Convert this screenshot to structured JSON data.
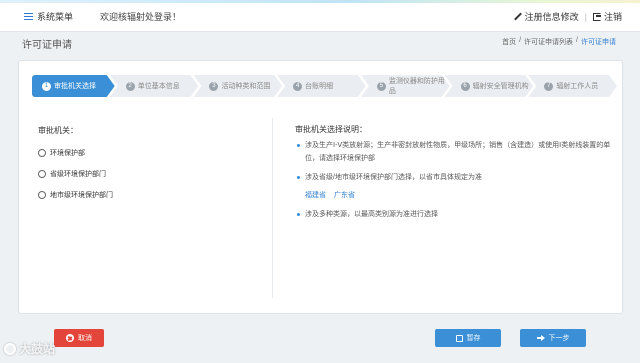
{
  "header": {
    "menu_label": "系统菜单",
    "welcome": "欢迎核辐射处登录！",
    "edit_label": "注册信息修改",
    "separator": "|",
    "logout_label": "注销"
  },
  "page": {
    "title": "许可证申请",
    "breadcrumb": [
      "首页",
      "/",
      "许可证申请列表",
      "/",
      "许可证申请"
    ]
  },
  "steps": [
    {
      "num": "1",
      "label": "审批机关选择",
      "active": true
    },
    {
      "num": "2",
      "label": "单位基本信息",
      "active": false
    },
    {
      "num": "3",
      "label": "活动种类和范围",
      "active": false
    },
    {
      "num": "4",
      "label": "台账明细",
      "active": false
    },
    {
      "num": "5",
      "label": "监测仪器和防护用品",
      "active": false
    },
    {
      "num": "6",
      "label": "辐射安全管理机构",
      "active": false
    },
    {
      "num": "7",
      "label": "辐射工作人员",
      "active": false
    }
  ],
  "form": {
    "label": "审批机关：",
    "options": [
      "环境保护部",
      "省级环境保护部门",
      "地市级环境保护部门"
    ]
  },
  "notes": {
    "title": "审批机关选择说明：",
    "item1": "涉及生产Ⅰ-Ⅴ类放射源；生产非密封放射性物质，甲级场所；销售（含建造）或使用Ⅰ类射线装置的单位，请选择环境保护部",
    "item2": "涉及省级/地市级环境保护部门选择，以省市具体规定为准",
    "provinces": [
      "福建省",
      "广东省"
    ],
    "item3": "涉及多种类源，以最高类别源为准进行选择"
  },
  "buttons": {
    "cancel": "取消",
    "save": "暂存",
    "next": "下一步"
  },
  "watermark": "大鼓站"
}
